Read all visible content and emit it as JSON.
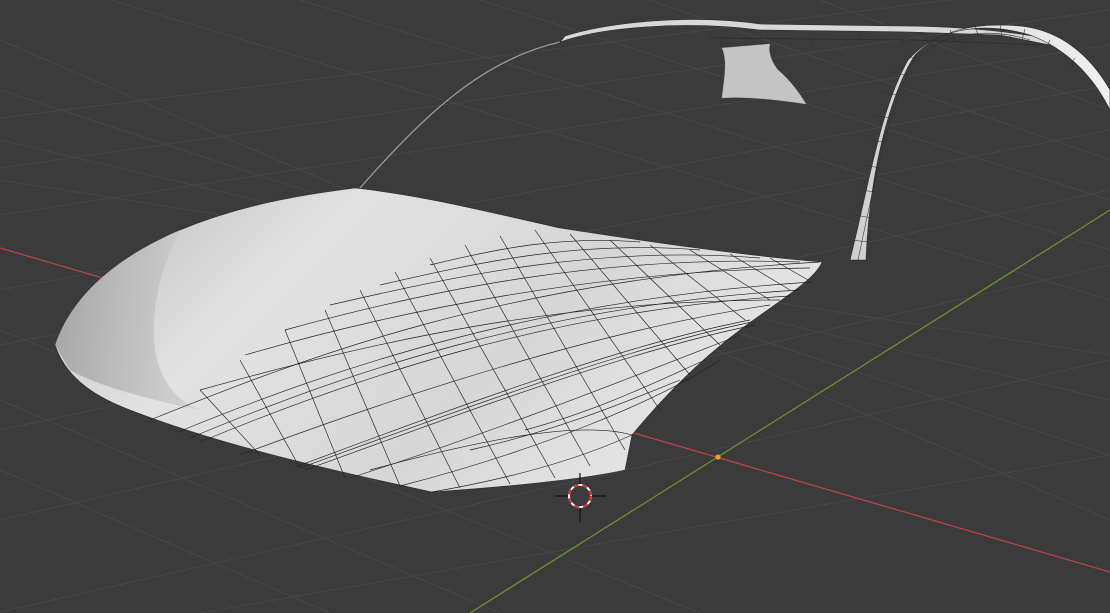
{
  "viewport": {
    "background_color": "#3b3b3b",
    "grid_color": "#4a4a4a",
    "x_axis_color": "#c0474a",
    "y_axis_color": "#6e9a2e",
    "origin_color": "#f0a020"
  },
  "mesh": {
    "surface_color": "#dcdcdc",
    "shade_color": "#a8a8a8",
    "wire_color": "#1e1e1e"
  },
  "cursor": {
    "ring_outer": "#d03030",
    "ring_inner": "#ffffff",
    "crosshair_color": "#111111"
  }
}
